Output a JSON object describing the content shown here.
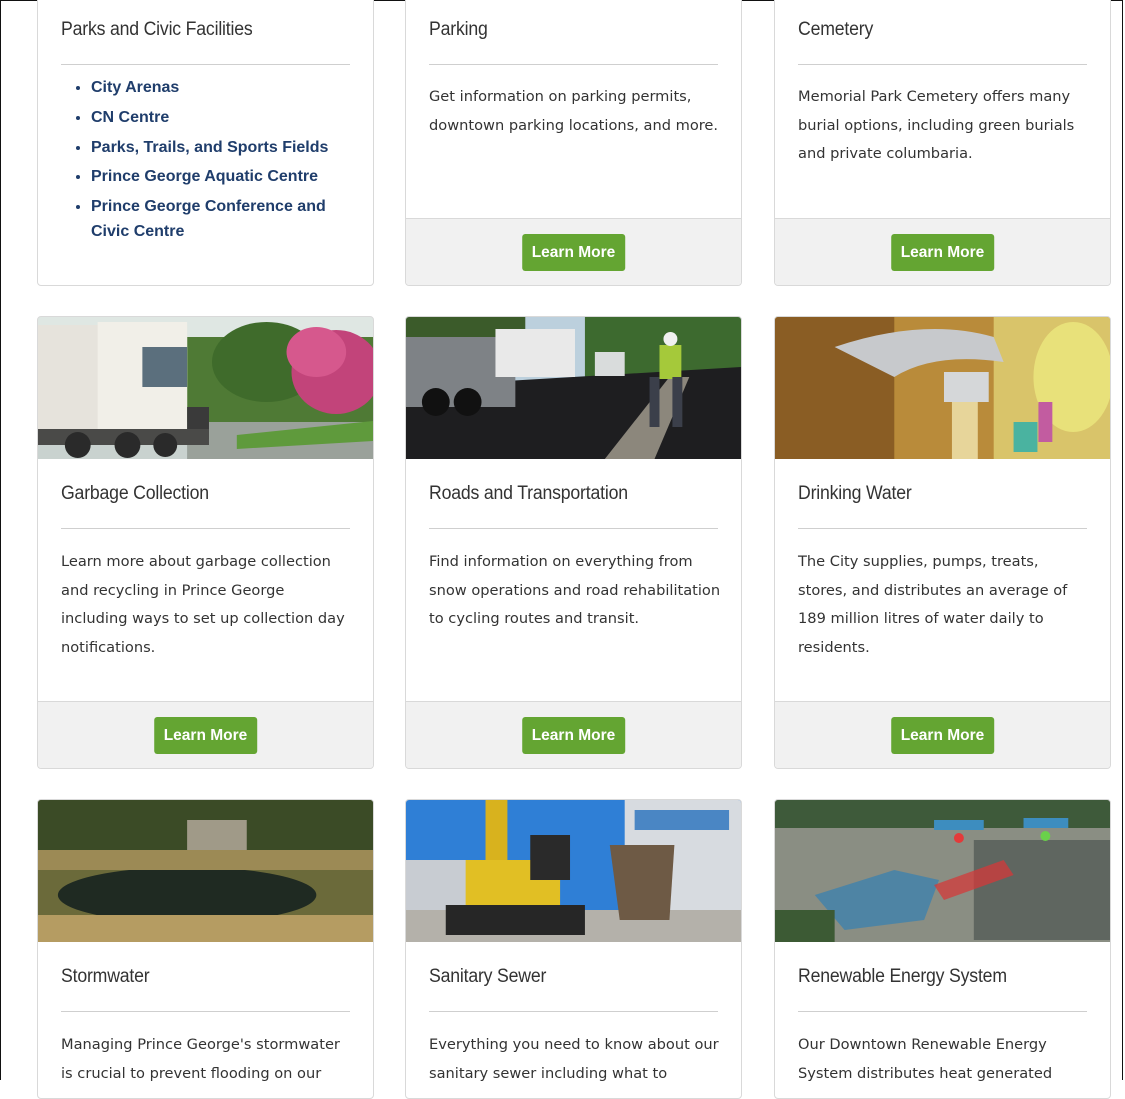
{
  "facilities": {
    "title": "Parks and Civic Facilities",
    "links": [
      "City Arenas",
      "CN Centre",
      "Parks, Trails, and Sports Fields",
      "Prince George Aquatic Centre",
      "Prince George Conference and Civic Centre"
    ]
  },
  "cards": {
    "parking": {
      "title": "Parking",
      "desc": "Get information on parking permits, downtown parking locations, and more.",
      "button": "Learn More"
    },
    "cemetery": {
      "title": "Cemetery",
      "desc": "Memorial Park Cemetery offers many burial options, including green burials and private columbaria.",
      "button": "Learn More"
    },
    "garbage": {
      "title": "Garbage Collection",
      "desc": "Learn more about garbage collection and recycling in Prince George including ways to set up collection day notifications.",
      "button": "Learn More"
    },
    "roads": {
      "title": "Roads and Transportation",
      "desc": "Find information on everything from snow operations and road rehabilitation to cycling routes and transit.",
      "button": "Learn More"
    },
    "water": {
      "title": "Drinking Water",
      "desc": "The City supplies, pumps, treats, stores, and distributes an average of 189 million litres of water daily to residents.",
      "button": "Learn More"
    },
    "stormwater": {
      "title": "Stormwater",
      "desc": "Managing Prince George's stormwater is crucial to prevent flooding on our"
    },
    "sewer": {
      "title": "Sanitary Sewer",
      "desc": "Everything you need to know about our sanitary sewer including what to"
    },
    "energy": {
      "title": "Renewable Energy System",
      "desc": "Our Downtown Renewable Energy System distributes heat generated"
    }
  },
  "colors": {
    "button": "#64a532",
    "link": "#1f3d6b",
    "footer_bg": "#f1f1f1"
  }
}
